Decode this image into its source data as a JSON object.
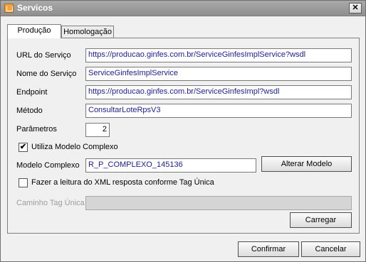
{
  "window": {
    "title": "Servicos",
    "close_glyph": "✕"
  },
  "tabs": [
    {
      "label": "Produção",
      "active": true
    },
    {
      "label": "Homologação",
      "active": false
    }
  ],
  "form": {
    "url": {
      "label": "URL do Serviço",
      "value": "https://producao.ginfes.com.br/ServiceGinfesImplService?wsdl"
    },
    "nome": {
      "label": "Nome do Serviço",
      "value": "ServiceGinfesImplService"
    },
    "endpoint": {
      "label": "Endpoint",
      "value": "https://producao.ginfes.com.br/ServiceGinfesImpl?wsdl"
    },
    "metodo": {
      "label": "Método",
      "value": "ConsultarLoteRpsV3"
    },
    "parametros": {
      "label": "Parâmetros",
      "value": "2"
    },
    "modelo_complexo_check": {
      "label": "Utiliza Modelo Complexo",
      "checked": true,
      "mark": "✔"
    },
    "modelo_complexo": {
      "label": "Modelo Complexo",
      "value": "R_P_COMPLEXO_145136"
    },
    "alterar_modelo_button": "Alterar Modelo",
    "tag_unica_check": {
      "label": "Fazer a leitura do XML resposta conforme Tag Única",
      "checked": false
    },
    "caminho_tag": {
      "label": "Caminho Tag Única",
      "value": ""
    },
    "carregar_button": "Carregar"
  },
  "footer": {
    "confirm_button": "Confirmar",
    "cancel_button": "Cancelar"
  }
}
